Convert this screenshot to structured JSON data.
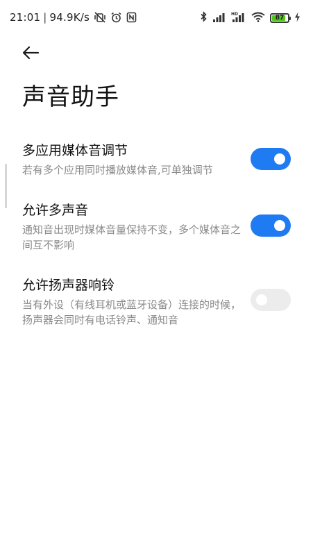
{
  "status_bar": {
    "time": "21:01",
    "network_speed": "94.9K/s",
    "battery_level": "87",
    "icons_left": [
      "mute-vibrate-icon",
      "alarm-icon",
      "nfc-icon"
    ],
    "icons_right": [
      "bluetooth-icon",
      "signal-icon",
      "hd-signal-icon",
      "wifi-icon",
      "battery-icon",
      "charging-icon"
    ]
  },
  "header": {
    "title": "声音助手"
  },
  "settings": [
    {
      "title": "多应用媒体音调节",
      "description": "若有多个应用同时播放媒体音,可单独调节",
      "enabled": true
    },
    {
      "title": "允许多声音",
      "description": "通知音出现时媒体音量保持不变，多个媒体音之间互不影响",
      "enabled": true
    },
    {
      "title": "允许扬声器响铃",
      "description": "当有外设（有线耳机或蓝牙设备）连接的时候，扬声器会同时有电话铃声、通知音",
      "enabled": false
    }
  ],
  "colors": {
    "accent": "#1f7bf2",
    "toggle_off": "#ececec",
    "battery_fill": "#52c41a"
  }
}
